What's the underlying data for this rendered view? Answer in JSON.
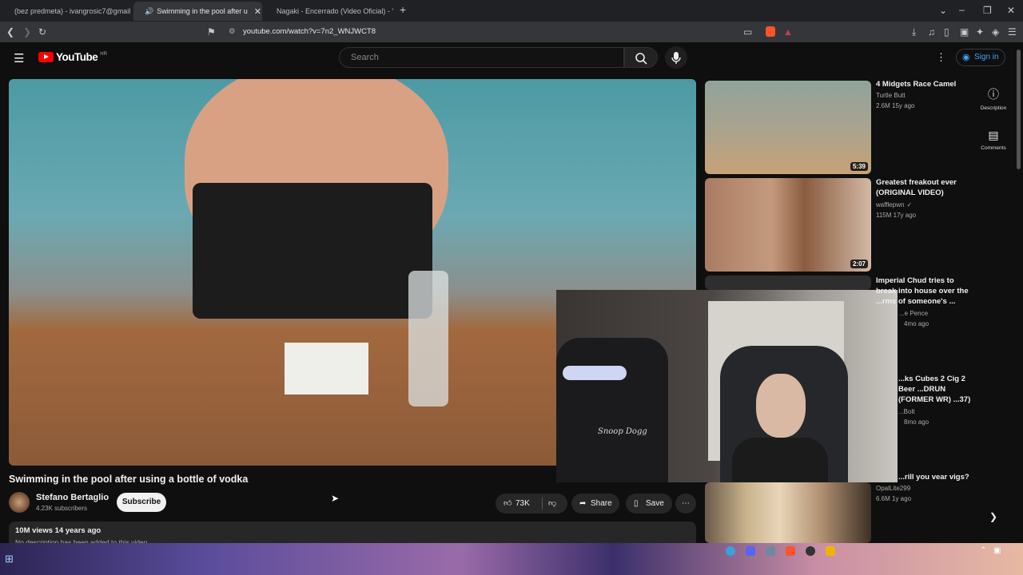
{
  "browser": {
    "tabs": [
      {
        "label": "(bez predmeta) - ivangrosic7@gmail.",
        "favicon": "gmail-icon"
      },
      {
        "label": "Swimming in the pool after u",
        "favicon": "youtube-icon",
        "active": true
      },
      {
        "label": "Nagaki - Encerrado (Video Oficial) - Y",
        "favicon": "youtube-icon"
      }
    ],
    "url": "youtube.com/watch?v=7n2_WNJWCT8"
  },
  "youtube": {
    "logo_text": "YouTube",
    "region": "HR",
    "search_placeholder": "Search",
    "signin_label": "Sign in"
  },
  "video": {
    "title": "Swimming in the pool after using a bottle of vodka",
    "channel": "Stefano Bertaglio",
    "subscribers": "4.23K subscribers",
    "subscribe_label": "Subscribe",
    "likes": "73K",
    "share_label": "Share",
    "save_label": "Save",
    "views_date": "10M views  14 years ago",
    "description": "No description has been added to this video."
  },
  "recommendations": [
    {
      "title": "4 Midgets Race Camel",
      "channel": "Turtle Butt",
      "stats": "2.6M  15y ago",
      "duration": "5:39"
    },
    {
      "title": "Greatest freakout ever (ORIGINAL VIDEO)",
      "channel": "wafflepwn",
      "stats": "115M  17y ago",
      "duration": "2:07"
    },
    {
      "title": "Imperial Chud tries to break into house over the ...rms of someone's ...",
      "channel": "...e Pence",
      "stats": "4mo ago",
      "duration": ""
    },
    {
      "title": "...ks Cubes 2 Cig 2 Beer ...DRUN (FORMER WR) ...37)",
      "channel": "...Bolt",
      "stats": "8mo ago",
      "duration": ""
    },
    {
      "title": "...rill you vear vigs?",
      "channel": "OpalLite299",
      "stats": "6.6M  1y ago",
      "duration": ""
    }
  ],
  "side_panel": {
    "description_label": "Description",
    "comments_label": "Comments"
  },
  "webcam_text": "Snoop Dogg"
}
